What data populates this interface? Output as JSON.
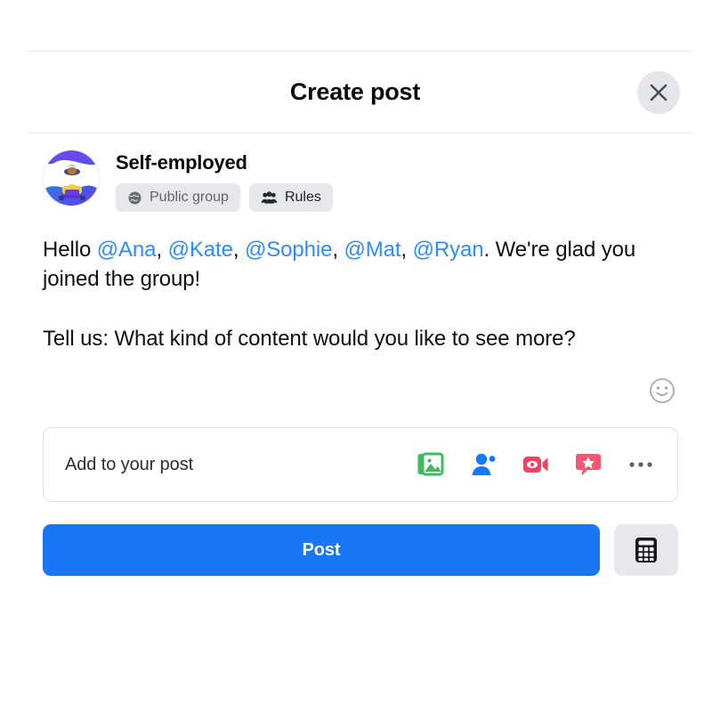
{
  "dialog": {
    "title": "Create post",
    "close_label": "Close",
    "close_icon": "close-icon"
  },
  "group": {
    "name": "Self-employed",
    "avatar_icon": "person-with-laptop-avatar",
    "pills": [
      {
        "label": "Public group",
        "icon": "globe-icon",
        "style": "muted"
      },
      {
        "label": "Rules",
        "icon": "people-group-icon",
        "style": "dark"
      }
    ]
  },
  "composer": {
    "paragraph_1": {
      "prefix": "Hello ",
      "mentions": [
        "@Ana",
        "@Kate",
        "@Sophie",
        "@Mat",
        "@Ryan"
      ],
      "separator": ", ",
      "suffix": ". We're glad you joined the group!"
    },
    "paragraph_2": "Tell us: What kind of content would you like to see more?",
    "emoji_button_icon": "smiley-face-icon"
  },
  "add_to_post": {
    "label": "Add to your post",
    "actions": [
      {
        "name": "photo-video-icon",
        "label": "Photo/video",
        "color": "#45bd62"
      },
      {
        "name": "tag-people-icon",
        "label": "Tag people",
        "color": "#1877f2"
      },
      {
        "name": "live-video-icon",
        "label": "Live video",
        "color": "#f3425f"
      },
      {
        "name": "feeling-activity-icon",
        "label": "Feeling/activity",
        "color": "#f3566f"
      },
      {
        "name": "more-options-icon",
        "label": "More options",
        "color": "#5a5f66"
      }
    ]
  },
  "footer": {
    "post_label": "Post",
    "post_color": "#1877f2",
    "calculator_icon": "calculator-icon"
  }
}
